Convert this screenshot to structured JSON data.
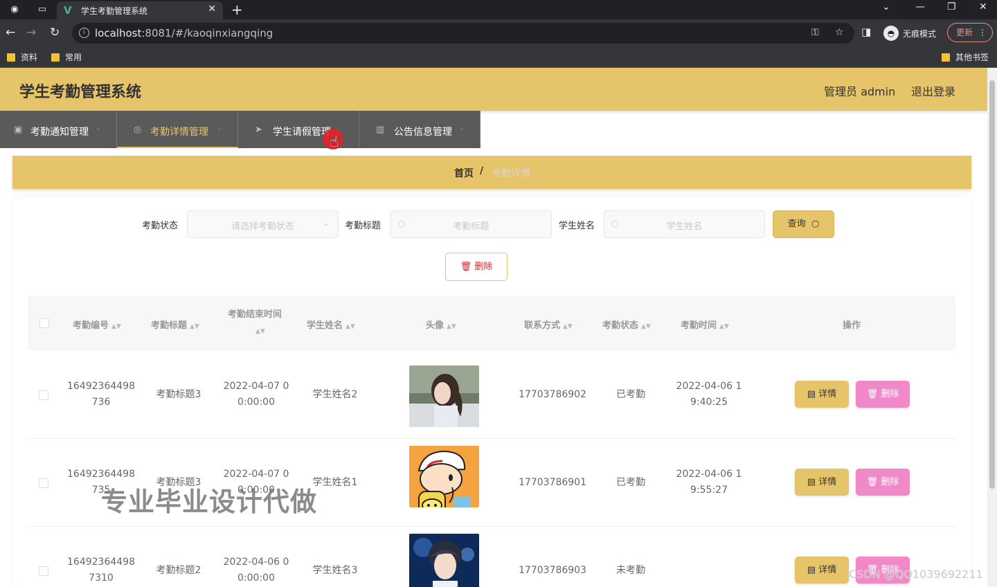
{
  "browser": {
    "tab_title": "学生考勤管理系统",
    "url_host": "localhost",
    "url_rest": ":8081/#/kaoqinxiangqing",
    "incognito_label": "无痕模式",
    "update_label": "更新",
    "bookmarks": [
      "资料",
      "常用"
    ],
    "other_bookmarks": "其他书签"
  },
  "app": {
    "title": "学生考勤管理系统",
    "admin": "管理员 admin",
    "logout": "退出登录"
  },
  "menu": [
    {
      "label": "考勤通知管理",
      "icon": "checkbox-icon"
    },
    {
      "label": "考勤详情管理",
      "icon": "compass-icon",
      "active": true
    },
    {
      "label": "学生请假管理",
      "icon": "send-icon"
    },
    {
      "label": "公告信息管理",
      "icon": "bar-chart-icon"
    }
  ],
  "breadcrumb": {
    "home": "首页",
    "sep": "/",
    "current": "考勤详情"
  },
  "search": {
    "status_label": "考勤状态",
    "status_placeholder": "请选择考勤状态",
    "title_label": "考勤标题",
    "title_placeholder": "考勤标题",
    "name_label": "学生姓名",
    "name_placeholder": "学生姓名",
    "query_label": "查询",
    "batch_delete_label": "删除"
  },
  "table": {
    "headers": {
      "id": "考勤编号",
      "title": "考勤标题",
      "end_time": "考勤结束时间",
      "name": "学生姓名",
      "avatar": "头像",
      "phone": "联系方式",
      "status": "考勤状态",
      "time": "考勤时间",
      "ops": "操作"
    },
    "rows": [
      {
        "id1": "16492364498",
        "id2": "736",
        "title": "考勤标题3",
        "end1": "2022-04-07 0",
        "end2": "0:00:00",
        "name": "学生姓名2",
        "phone": "17703786902",
        "status": "已考勤",
        "time1": "2022-04-06 1",
        "time2": "9:40:25"
      },
      {
        "id1": "16492364498",
        "id2": "735",
        "title": "考勤标题3",
        "end1": "2022-04-07 0",
        "end2": "0:00:00",
        "name": "学生姓名1",
        "phone": "17703786901",
        "status": "已考勤",
        "time1": "2022-04-06 1",
        "time2": "9:55:27"
      },
      {
        "id1": "16492364498",
        "id2": "7310",
        "title": "考勤标题2",
        "end1": "2022-04-06 0",
        "end2": "0:00:00",
        "name": "学生姓名3",
        "phone": "17703786903",
        "status": "未考勤",
        "time1": "",
        "time2": ""
      }
    ],
    "detail_label": "详情",
    "delete_label": "删除"
  },
  "watermark": "专业毕业设计代做",
  "csdn": "CSDN @QQ1039692211",
  "colors": {
    "accent": "#e6c46a",
    "menu_bg": "#5a5a5a",
    "delete_pink": "#f188c8"
  }
}
